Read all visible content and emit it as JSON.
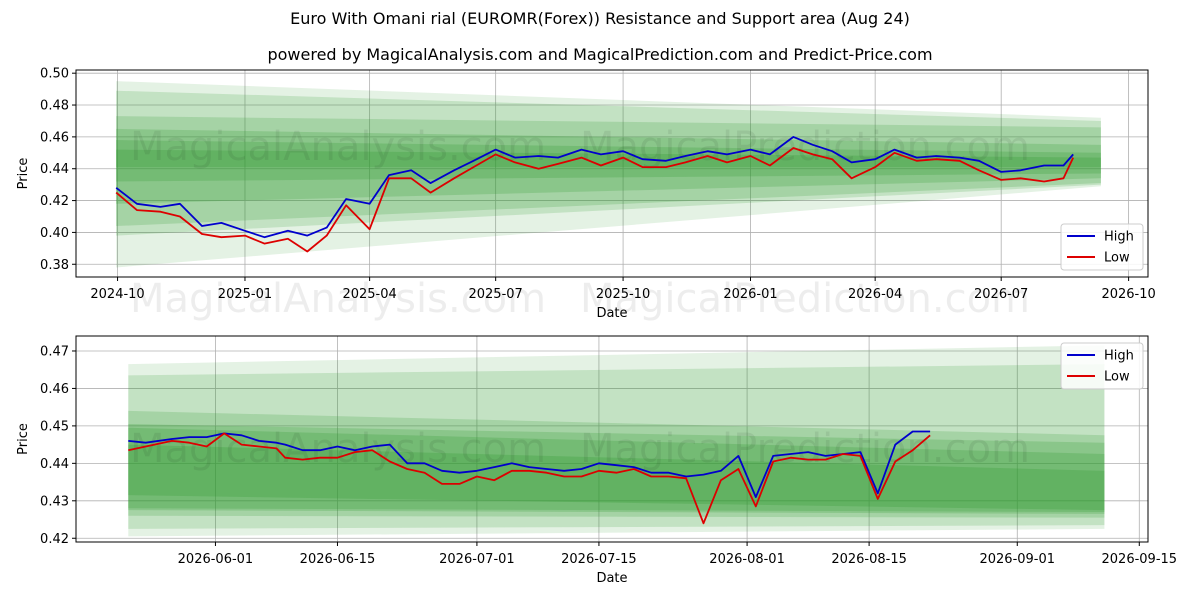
{
  "title": "Euro With Omani rial (EUROMR(Forex)) Resistance and Support area (Aug 24)",
  "subtitle": "powered by MagicalAnalysis.com and MagicalPrediction.com and Predict-Price.com",
  "watermarks": [
    "MagicalAnalysis.com",
    "MagicalPrediction.com"
  ],
  "colors": {
    "high": "#0000cc",
    "low": "#dd0000",
    "band": "#2e9a2e"
  },
  "chart_data": [
    {
      "type": "line",
      "xlabel": "Date",
      "ylabel": "Price",
      "xlim": [
        "2024-09-01",
        "2026-10-15"
      ],
      "ylim": [
        0.372,
        0.502
      ],
      "x_ticks": [
        "2024-10",
        "2025-01",
        "2025-04",
        "2025-07",
        "2025-10",
        "2026-01",
        "2026-04",
        "2026-07",
        "2026-10"
      ],
      "y_ticks": [
        "0.38",
        "0.40",
        "0.42",
        "0.44",
        "0.46",
        "0.48",
        "0.50"
      ],
      "grid": true,
      "legend": "lower-right",
      "series": [
        {
          "name": "High",
          "x": [
            "2024-09-30",
            "2024-10-15",
            "2024-11-01",
            "2024-11-15",
            "2024-12-01",
            "2024-12-15",
            "2025-01-01",
            "2025-01-15",
            "2025-02-01",
            "2025-02-15",
            "2025-03-01",
            "2025-03-15",
            "2025-04-01",
            "2025-04-15",
            "2025-05-01",
            "2025-05-15",
            "2025-06-01",
            "2025-06-15",
            "2025-07-01",
            "2025-07-15",
            "2025-08-01",
            "2025-08-15",
            "2025-09-01",
            "2025-09-15",
            "2025-10-01",
            "2025-10-15",
            "2025-11-01",
            "2025-11-15",
            "2025-12-01",
            "2025-12-15",
            "2026-01-01",
            "2026-01-15",
            "2026-02-01",
            "2026-02-15",
            "2026-03-01",
            "2026-03-15",
            "2026-04-01",
            "2026-04-15",
            "2026-05-01",
            "2026-05-15",
            "2026-06-01",
            "2026-06-15",
            "2026-07-01",
            "2026-07-15",
            "2026-08-01",
            "2026-08-15",
            "2026-08-22"
          ],
          "values": [
            0.428,
            0.418,
            0.416,
            0.418,
            0.404,
            0.406,
            0.401,
            0.397,
            0.401,
            0.398,
            0.403,
            0.421,
            0.418,
            0.436,
            0.439,
            0.431,
            0.439,
            0.445,
            0.452,
            0.447,
            0.448,
            0.447,
            0.452,
            0.449,
            0.451,
            0.446,
            0.445,
            0.448,
            0.451,
            0.449,
            0.452,
            0.449,
            0.46,
            0.455,
            0.451,
            0.444,
            0.446,
            0.452,
            0.447,
            0.448,
            0.447,
            0.445,
            0.438,
            0.439,
            0.442,
            0.442,
            0.449
          ]
        },
        {
          "name": "Low",
          "x": [
            "2024-09-30",
            "2024-10-15",
            "2024-11-01",
            "2024-11-15",
            "2024-12-01",
            "2024-12-15",
            "2025-01-01",
            "2025-01-15",
            "2025-02-01",
            "2025-02-15",
            "2025-03-01",
            "2025-03-15",
            "2025-04-01",
            "2025-04-15",
            "2025-05-01",
            "2025-05-15",
            "2025-06-01",
            "2025-06-15",
            "2025-07-01",
            "2025-07-15",
            "2025-08-01",
            "2025-08-15",
            "2025-09-01",
            "2025-09-15",
            "2025-10-01",
            "2025-10-15",
            "2025-11-01",
            "2025-11-15",
            "2025-12-01",
            "2025-12-15",
            "2026-01-01",
            "2026-01-15",
            "2026-02-01",
            "2026-02-15",
            "2026-03-01",
            "2026-03-15",
            "2026-04-01",
            "2026-04-15",
            "2026-05-01",
            "2026-05-15",
            "2026-06-01",
            "2026-06-15",
            "2026-07-01",
            "2026-07-15",
            "2026-08-01",
            "2026-08-15",
            "2026-08-22"
          ],
          "values": [
            0.425,
            0.414,
            0.413,
            0.41,
            0.399,
            0.397,
            0.398,
            0.393,
            0.396,
            0.388,
            0.398,
            0.417,
            0.402,
            0.434,
            0.434,
            0.425,
            0.434,
            0.441,
            0.449,
            0.444,
            0.44,
            0.443,
            0.447,
            0.442,
            0.447,
            0.441,
            0.441,
            0.444,
            0.448,
            0.444,
            0.448,
            0.442,
            0.453,
            0.449,
            0.446,
            0.434,
            0.441,
            0.45,
            0.445,
            0.446,
            0.445,
            0.439,
            0.433,
            0.434,
            0.432,
            0.434,
            0.447
          ]
        }
      ],
      "bands": {
        "x": [
          "2024-09-30",
          "2026-09-11"
        ],
        "upper": [
          [
            0.495,
            0.472
          ],
          [
            0.489,
            0.47
          ],
          [
            0.473,
            0.466
          ],
          [
            0.465,
            0.455
          ],
          [
            0.458,
            0.45
          ],
          [
            0.452,
            0.447
          ]
        ],
        "lower": [
          [
            0.378,
            0.429
          ],
          [
            0.398,
            0.43
          ],
          [
            0.404,
            0.431
          ],
          [
            0.418,
            0.434
          ],
          [
            0.432,
            0.437
          ],
          [
            0.441,
            0.441
          ]
        ]
      }
    },
    {
      "type": "line",
      "xlabel": "Date",
      "ylabel": "Price",
      "xlim": [
        "2026-05-16",
        "2026-09-16"
      ],
      "ylim": [
        0.419,
        0.474
      ],
      "x_ticks": [
        "2026-06-01",
        "2026-06-15",
        "2026-07-01",
        "2026-07-15",
        "2026-08-01",
        "2026-08-15",
        "2026-09-01",
        "2026-09-15"
      ],
      "y_ticks": [
        "0.42",
        "0.43",
        "0.44",
        "0.45",
        "0.46",
        "0.47"
      ],
      "grid": true,
      "legend": "upper-right",
      "series": [
        {
          "name": "High",
          "x": [
            "2026-05-22",
            "2026-05-24",
            "2026-05-27",
            "2026-05-29",
            "2026-05-31",
            "2026-06-02",
            "2026-06-04",
            "2026-06-06",
            "2026-06-08",
            "2026-06-09",
            "2026-06-11",
            "2026-06-13",
            "2026-06-15",
            "2026-06-17",
            "2026-06-19",
            "2026-06-21",
            "2026-06-23",
            "2026-06-25",
            "2026-06-27",
            "2026-06-29",
            "2026-07-01",
            "2026-07-03",
            "2026-07-05",
            "2026-07-07",
            "2026-07-09",
            "2026-07-11",
            "2026-07-13",
            "2026-07-15",
            "2026-07-17",
            "2026-07-19",
            "2026-07-21",
            "2026-07-23",
            "2026-07-25",
            "2026-07-27",
            "2026-07-29",
            "2026-07-31",
            "2026-08-02",
            "2026-08-04",
            "2026-08-06",
            "2026-08-08",
            "2026-08-10",
            "2026-08-12",
            "2026-08-14",
            "2026-08-16",
            "2026-08-18",
            "2026-08-20",
            "2026-08-22"
          ],
          "values": [
            0.446,
            0.4455,
            0.4465,
            0.447,
            0.447,
            0.448,
            0.4475,
            0.446,
            0.4455,
            0.445,
            0.4435,
            0.4435,
            0.4445,
            0.4435,
            0.4445,
            0.445,
            0.44,
            0.44,
            0.438,
            0.4375,
            0.438,
            0.439,
            0.44,
            0.439,
            0.4385,
            0.438,
            0.4385,
            0.44,
            0.4395,
            0.439,
            0.4375,
            0.4375,
            0.4365,
            0.437,
            0.438,
            0.442,
            0.431,
            0.442,
            0.4425,
            0.443,
            0.442,
            0.4425,
            0.443,
            0.432,
            0.445,
            0.4485,
            0.4485
          ]
        },
        {
          "name": "Low",
          "x": [
            "2026-05-22",
            "2026-05-24",
            "2026-05-27",
            "2026-05-29",
            "2026-05-31",
            "2026-06-02",
            "2026-06-04",
            "2026-06-06",
            "2026-06-08",
            "2026-06-09",
            "2026-06-11",
            "2026-06-13",
            "2026-06-15",
            "2026-06-17",
            "2026-06-19",
            "2026-06-21",
            "2026-06-23",
            "2026-06-25",
            "2026-06-27",
            "2026-06-29",
            "2026-07-01",
            "2026-07-03",
            "2026-07-05",
            "2026-07-07",
            "2026-07-09",
            "2026-07-11",
            "2026-07-13",
            "2026-07-15",
            "2026-07-17",
            "2026-07-19",
            "2026-07-21",
            "2026-07-23",
            "2026-07-25",
            "2026-07-27",
            "2026-07-29",
            "2026-07-31",
            "2026-08-02",
            "2026-08-04",
            "2026-08-06",
            "2026-08-08",
            "2026-08-10",
            "2026-08-12",
            "2026-08-14",
            "2026-08-16",
            "2026-08-18",
            "2026-08-20",
            "2026-08-22"
          ],
          "values": [
            0.4435,
            0.4445,
            0.446,
            0.4455,
            0.4445,
            0.448,
            0.445,
            0.4445,
            0.444,
            0.4415,
            0.441,
            0.4415,
            0.4415,
            0.443,
            0.4435,
            0.4405,
            0.4385,
            0.4375,
            0.4345,
            0.4345,
            0.4365,
            0.4355,
            0.438,
            0.438,
            0.4375,
            0.4365,
            0.4365,
            0.438,
            0.4375,
            0.4385,
            0.4365,
            0.4365,
            0.436,
            0.424,
            0.4355,
            0.4385,
            0.4285,
            0.4405,
            0.4415,
            0.441,
            0.441,
            0.4425,
            0.442,
            0.4305,
            0.4405,
            0.4435,
            0.4475
          ]
        }
      ],
      "bands": {
        "x": [
          "2026-05-22",
          "2026-09-11"
        ],
        "upper": [
          [
            0.4665,
            0.4715
          ],
          [
            0.4635,
            0.4665
          ],
          [
            0.454,
            0.4475
          ],
          [
            0.4505,
            0.4455
          ],
          [
            0.4495,
            0.4425
          ],
          [
            0.445,
            0.438
          ]
        ],
        "lower": [
          [
            0.4205,
            0.4225
          ],
          [
            0.4225,
            0.4235
          ],
          [
            0.426,
            0.4255
          ],
          [
            0.4275,
            0.4265
          ],
          [
            0.428,
            0.427
          ],
          [
            0.4315,
            0.4275
          ]
        ]
      }
    }
  ],
  "legend": {
    "high_label": "High",
    "low_label": "Low"
  }
}
